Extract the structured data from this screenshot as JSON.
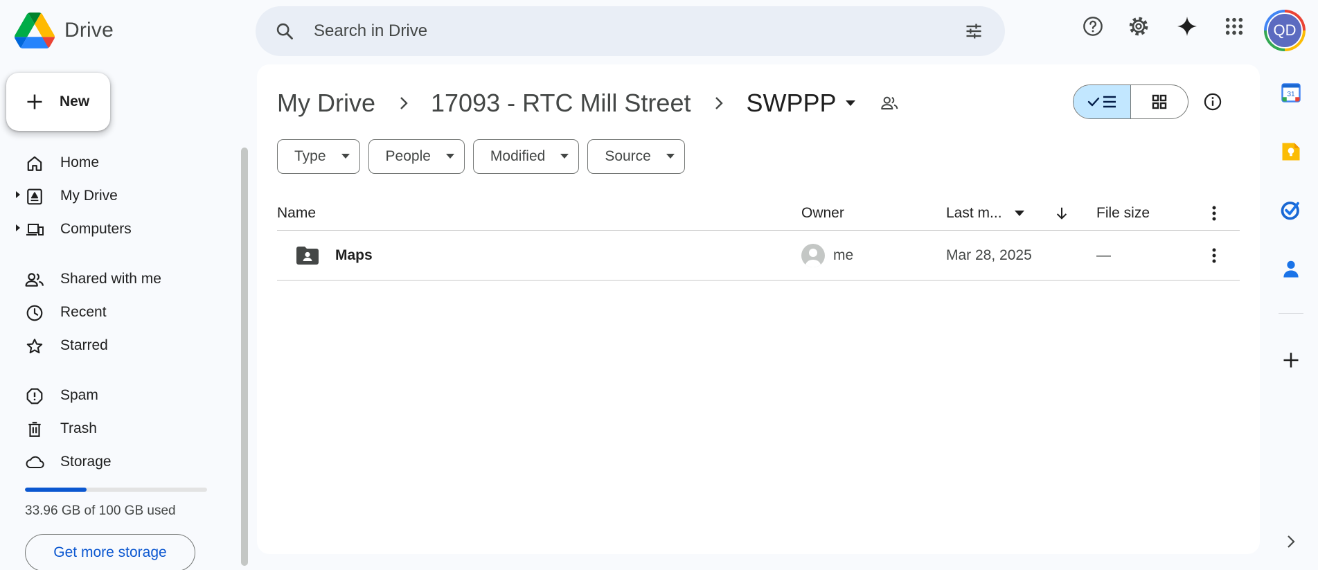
{
  "app": {
    "name": "Drive"
  },
  "search": {
    "placeholder": "Search in Drive"
  },
  "user": {
    "initials": "QD"
  },
  "sidebar": {
    "new_label": "New",
    "items": [
      {
        "label": "Home",
        "icon": "home-icon"
      },
      {
        "label": "My Drive",
        "icon": "my-drive-icon"
      },
      {
        "label": "Computers",
        "icon": "computers-icon"
      },
      {
        "label": "Shared with me",
        "icon": "shared-icon"
      },
      {
        "label": "Recent",
        "icon": "clock-icon"
      },
      {
        "label": "Starred",
        "icon": "star-icon"
      },
      {
        "label": "Spam",
        "icon": "spam-icon"
      },
      {
        "label": "Trash",
        "icon": "trash-icon"
      },
      {
        "label": "Storage",
        "icon": "cloud-icon"
      }
    ],
    "storage": {
      "used_text": "33.96 GB of 100 GB used",
      "used_fraction": 0.3396,
      "cta": "Get more storage"
    }
  },
  "breadcrumb": {
    "items": [
      "My Drive",
      "17093 - RTC Mill Street"
    ],
    "current": "SWPPP"
  },
  "filters": [
    "Type",
    "People",
    "Modified",
    "Source"
  ],
  "table": {
    "columns": {
      "name": "Name",
      "owner": "Owner",
      "modified": "Last m...",
      "size": "File size"
    },
    "rows": [
      {
        "name": "Maps",
        "owner": "me",
        "modified": "Mar 28, 2025",
        "size": "—",
        "type": "shared-folder"
      }
    ]
  },
  "colors": {
    "accent": "#0b57d0",
    "toggle_on": "#c2e7ff",
    "search_bg": "#e9eef6",
    "page_bg": "#f8fafd"
  }
}
